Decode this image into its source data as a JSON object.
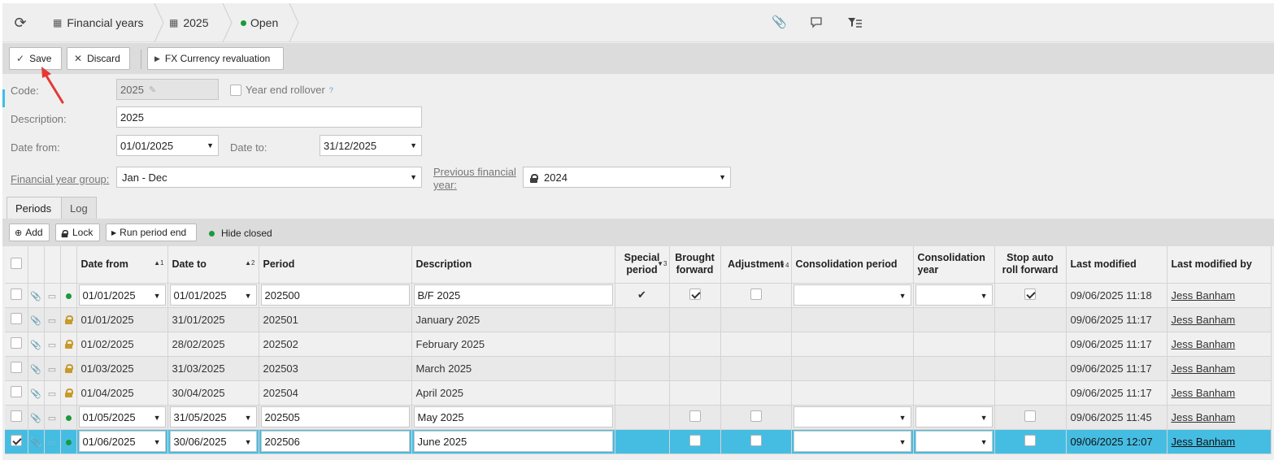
{
  "breadcrumb": {
    "root": "Financial years",
    "year": "2025",
    "status": "Open"
  },
  "icons": {
    "refresh": "refresh-icon",
    "calendar": "calendar-icon",
    "attach": "paperclip-icon",
    "comment": "comment-icon",
    "filter": "filter-list-icon"
  },
  "toolbar": {
    "save": "Save",
    "discard": "Discard",
    "fx": "FX Currency revaluation"
  },
  "form": {
    "code_label": "Code:",
    "code_value": "2025",
    "year_end_label": "Year end rollover",
    "year_end_help": "?",
    "description_label": "Description:",
    "description_value": "2025",
    "date_from_label": "Date from:",
    "date_from_value": "01/01/2025",
    "date_to_label": "Date to:",
    "date_to_value": "31/12/2025",
    "group_label": "Financial year group:",
    "group_value": "Jan - Dec",
    "prev_label_1": "Previous financial",
    "prev_label_2": "year:",
    "prev_value": "2024"
  },
  "tabs": [
    "Periods",
    "Log"
  ],
  "grid_toolbar": {
    "add": "Add",
    "lock": "Lock",
    "run": "Run period end",
    "hide_closed": "Hide closed"
  },
  "columns": {
    "date_from": "Date from",
    "date_from_sort": "▲1",
    "date_to": "Date to",
    "date_to_sort": "▲2",
    "period": "Period",
    "description": "Description",
    "special_1": "Special",
    "special_2": "period",
    "special_sort": "▼3",
    "brought_1": "Brought",
    "brought_2": "forward",
    "adjustment": "Adjustment",
    "adjustment_sort": "▼4",
    "consolidation_period": "Consolidation period",
    "consolidation_year_1": "Consolidation",
    "consolidation_year_2": "year",
    "stop_1": "Stop auto",
    "stop_2": "roll forward",
    "last_modified": "Last modified",
    "last_modified_by": "Last modified by"
  },
  "rows": [
    {
      "date_from": "01/01/2025",
      "date_to": "01/01/2025",
      "period": "202500",
      "description": "B/F 2025",
      "last_modified": "09/06/2025 11:18",
      "by": "Jess Banham"
    },
    {
      "date_from": "01/01/2025",
      "date_to": "31/01/2025",
      "period": "202501",
      "description": "January 2025",
      "last_modified": "09/06/2025 11:17",
      "by": "Jess Banham"
    },
    {
      "date_from": "01/02/2025",
      "date_to": "28/02/2025",
      "period": "202502",
      "description": "February 2025",
      "last_modified": "09/06/2025 11:17",
      "by": "Jess Banham"
    },
    {
      "date_from": "01/03/2025",
      "date_to": "31/03/2025",
      "period": "202503",
      "description": "March 2025",
      "last_modified": "09/06/2025 11:17",
      "by": "Jess Banham"
    },
    {
      "date_from": "01/04/2025",
      "date_to": "30/04/2025",
      "period": "202504",
      "description": "April 2025",
      "last_modified": "09/06/2025 11:17",
      "by": "Jess Banham"
    },
    {
      "date_from": "01/05/2025",
      "date_to": "31/05/2025",
      "period": "202505",
      "description": "May 2025",
      "last_modified": "09/06/2025 11:45",
      "by": "Jess Banham"
    },
    {
      "date_from": "01/06/2025",
      "date_to": "30/06/2025",
      "period": "202506",
      "description": "June 2025",
      "last_modified": "09/06/2025 12:07",
      "by": "Jess Banham"
    }
  ],
  "colors": {
    "accent": "#45bde3",
    "status_open": "#1a9a3a",
    "lock": "#c89a2a",
    "annotation_arrow": "#e53935"
  }
}
